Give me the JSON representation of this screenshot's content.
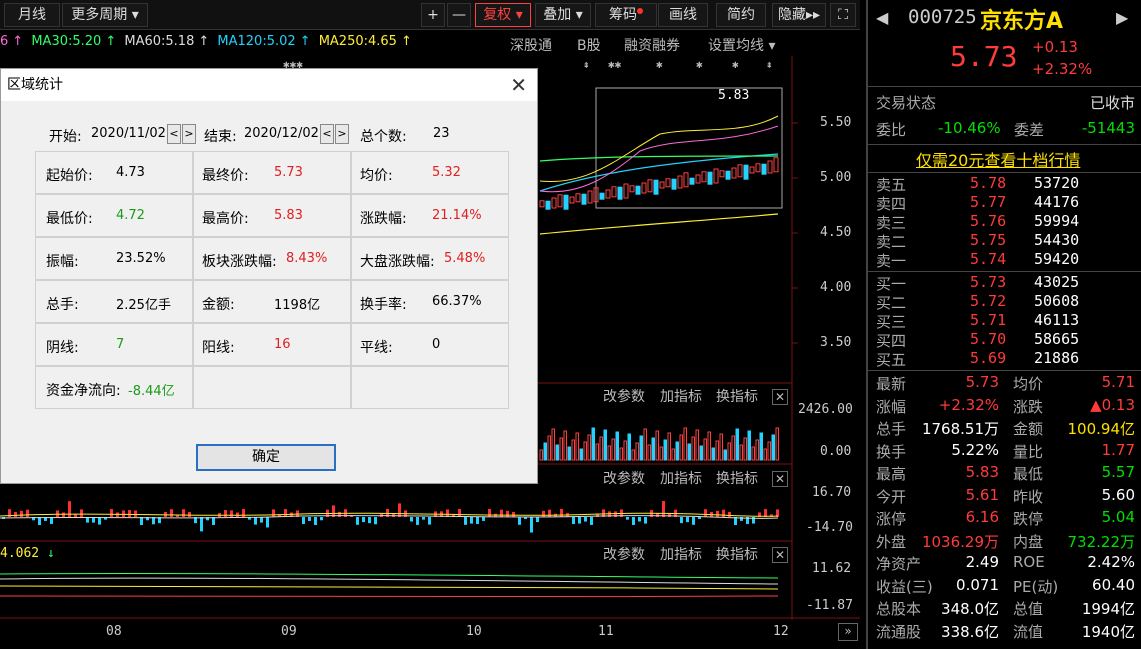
{
  "toolbar": {
    "monthly": "月线",
    "more_periods": "更多周期",
    "plus": "+",
    "minus": "—",
    "fuquan": "复权",
    "overlay": "叠加",
    "chips": "筹码",
    "draw": "画线",
    "simple": "简约",
    "hide": "隐藏"
  },
  "ma_legend": {
    "ma20_tail": "6",
    "ma30": "MA30:5.20",
    "ma60": "MA60:5.18",
    "ma120": "MA120:5.02",
    "ma250": "MA250:4.65"
  },
  "chart_tabs": [
    "深股通",
    "B股",
    "融资融券",
    "设置均线"
  ],
  "price_axis": [
    "5.50",
    "5.00",
    "4.50",
    "4.00",
    "3.50"
  ],
  "range_box_label": "5.83",
  "volume_axis": [
    "2426.00",
    "0.00"
  ],
  "macd_axis": [
    "16.70",
    "-14.70"
  ],
  "indicator_axis": [
    "11.62",
    "-11.87"
  ],
  "indicator_value": "4.062",
  "panel_tools": [
    "改参数",
    "加指标",
    "换指标"
  ],
  "x_axis": [
    "08",
    "09",
    "10",
    "11",
    "12"
  ],
  "quote": {
    "code": "000725",
    "name": "京东方A",
    "price": "5.73",
    "change": "+0.13",
    "change_pct": "+2.32%",
    "status_label": "交易状态",
    "status_value": "已收市",
    "weibi_label": "委比",
    "weibi_value": "-10.46%",
    "weicha_label": "委差",
    "weicha_value": "-51443",
    "promo": "仅需20元查看十档行情",
    "asks": [
      {
        "label": "卖五",
        "price": "5.78",
        "vol": "53720"
      },
      {
        "label": "卖四",
        "price": "5.77",
        "vol": "44176"
      },
      {
        "label": "卖三",
        "price": "5.76",
        "vol": "59994"
      },
      {
        "label": "卖二",
        "price": "5.75",
        "vol": "54430"
      },
      {
        "label": "卖一",
        "price": "5.74",
        "vol": "59420"
      }
    ],
    "bids": [
      {
        "label": "买一",
        "price": "5.73",
        "vol": "43025"
      },
      {
        "label": "买二",
        "price": "5.72",
        "vol": "50608"
      },
      {
        "label": "买三",
        "price": "5.71",
        "vol": "46113"
      },
      {
        "label": "买四",
        "price": "5.70",
        "vol": "58665"
      },
      {
        "label": "买五",
        "price": "5.69",
        "vol": "21886"
      }
    ],
    "stats": [
      {
        "l1": "最新",
        "v1": "5.73",
        "c1": "red",
        "l2": "均价",
        "v2": "5.71",
        "c2": "red"
      },
      {
        "l1": "涨幅",
        "v1": "+2.32%",
        "c1": "red",
        "l2": "涨跌",
        "v2": "▲0.13",
        "c2": "red"
      },
      {
        "l1": "总手",
        "v1": "1768.51万",
        "c1": "white",
        "l2": "金额",
        "v2": "100.94亿",
        "c2": "yellow"
      },
      {
        "l1": "换手",
        "v1": "5.22%",
        "c1": "white",
        "l2": "量比",
        "v2": "1.77",
        "c2": "red"
      },
      {
        "l1": "最高",
        "v1": "5.83",
        "c1": "red",
        "l2": "最低",
        "v2": "5.57",
        "c2": "green"
      },
      {
        "l1": "今开",
        "v1": "5.61",
        "c1": "red",
        "l2": "昨收",
        "v2": "5.60",
        "c2": "white"
      },
      {
        "l1": "涨停",
        "v1": "6.16",
        "c1": "red",
        "l2": "跌停",
        "v2": "5.04",
        "c2": "green"
      },
      {
        "l1": "外盘",
        "v1": "1036.29万",
        "c1": "red",
        "l2": "内盘",
        "v2": "732.22万",
        "c2": "green"
      },
      {
        "l1": "净资产",
        "v1": "2.49",
        "c1": "white",
        "l2": "ROE",
        "v2": "2.42%",
        "c2": "white"
      },
      {
        "l1": "收益(三)",
        "v1": "0.071",
        "c1": "white",
        "l2": "PE(动)",
        "v2": "60.40",
        "c2": "white"
      },
      {
        "l1": "总股本",
        "v1": "348.0亿",
        "c1": "white",
        "l2": "总值",
        "v2": "1994亿",
        "c2": "white"
      },
      {
        "l1": "流通股",
        "v1": "338.6亿",
        "c1": "white",
        "l2": "流值",
        "v2": "1940亿",
        "c2": "white"
      }
    ]
  },
  "dialog": {
    "title": "区域统计",
    "start_label": "开始:",
    "start_date": "2020/11/02",
    "end_label": "结束:",
    "end_date": "2020/12/02",
    "count_label": "总个数:",
    "count_value": "23",
    "cells": [
      {
        "label": "起始价:",
        "value": "4.73",
        "color": "#000000"
      },
      {
        "label": "最终价:",
        "value": "5.73",
        "color": "#e02020"
      },
      {
        "label": "均价:",
        "value": "5.32",
        "color": "#e02020"
      },
      {
        "label": "最低价:",
        "value": "4.72",
        "color": "#1a9a1a"
      },
      {
        "label": "最高价:",
        "value": "5.83",
        "color": "#e02020"
      },
      {
        "label": "涨跌幅:",
        "value": "21.14%",
        "color": "#e02020"
      },
      {
        "label": "振幅:",
        "value": "23.52%",
        "color": "#000000"
      },
      {
        "label": "板块涨跌幅:",
        "value": "8.43%",
        "color": "#e02020"
      },
      {
        "label": "大盘涨跌幅:",
        "value": "5.48%",
        "color": "#e02020"
      },
      {
        "label": "总手:",
        "value": "2.25亿手",
        "color": "#000000"
      },
      {
        "label": "金额:",
        "value": "1198亿",
        "color": "#000000"
      },
      {
        "label": "换手率:",
        "value": "66.37%",
        "color": "#000000"
      },
      {
        "label": "阴线:",
        "value": "7",
        "color": "#1a9a1a"
      },
      {
        "label": "阳线:",
        "value": "16",
        "color": "#e02020"
      },
      {
        "label": "平线:",
        "value": "0",
        "color": "#000000"
      },
      {
        "label": "资金净流向:",
        "value": "-8.44亿",
        "color": "#1a9a1a"
      }
    ],
    "ok": "确定"
  }
}
